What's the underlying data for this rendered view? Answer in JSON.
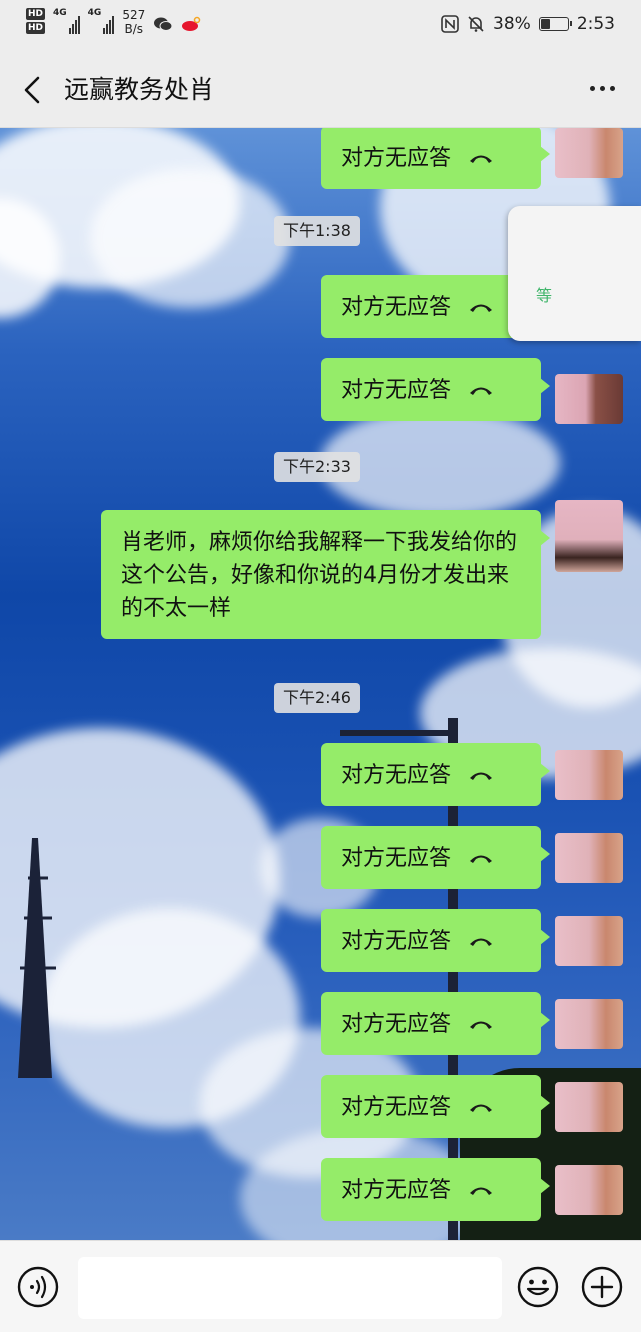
{
  "status_bar": {
    "hd1": "HD",
    "hd2": "HD",
    "net1": "4G",
    "net2": "4G",
    "speed_value": "527",
    "speed_unit": "B/s",
    "battery": "38%",
    "time": "2:53"
  },
  "header": {
    "title": "远赢教务处肖"
  },
  "popup": {
    "text": "等"
  },
  "messages": {
    "call_label": "对方无应答",
    "ts1": "下午1:38",
    "ts2": "下午2:33",
    "ts3": "下午2:46",
    "long_text": "肖老师，麻烦你给我解释一下我发给你的这个公告，好像和你说的4月份才发出来的不太一样"
  },
  "icons": {
    "back": "chevron-left-icon",
    "more": "more-dots-icon",
    "call": "hang-up-phone-icon",
    "voice": "voice-icon",
    "emoji": "emoji-icon",
    "plus": "plus-icon"
  },
  "colors": {
    "bubble": "#95ec69",
    "header_bg": "#ededed",
    "popup_accent": "#3fb56a"
  },
  "battery_level": 0.38
}
